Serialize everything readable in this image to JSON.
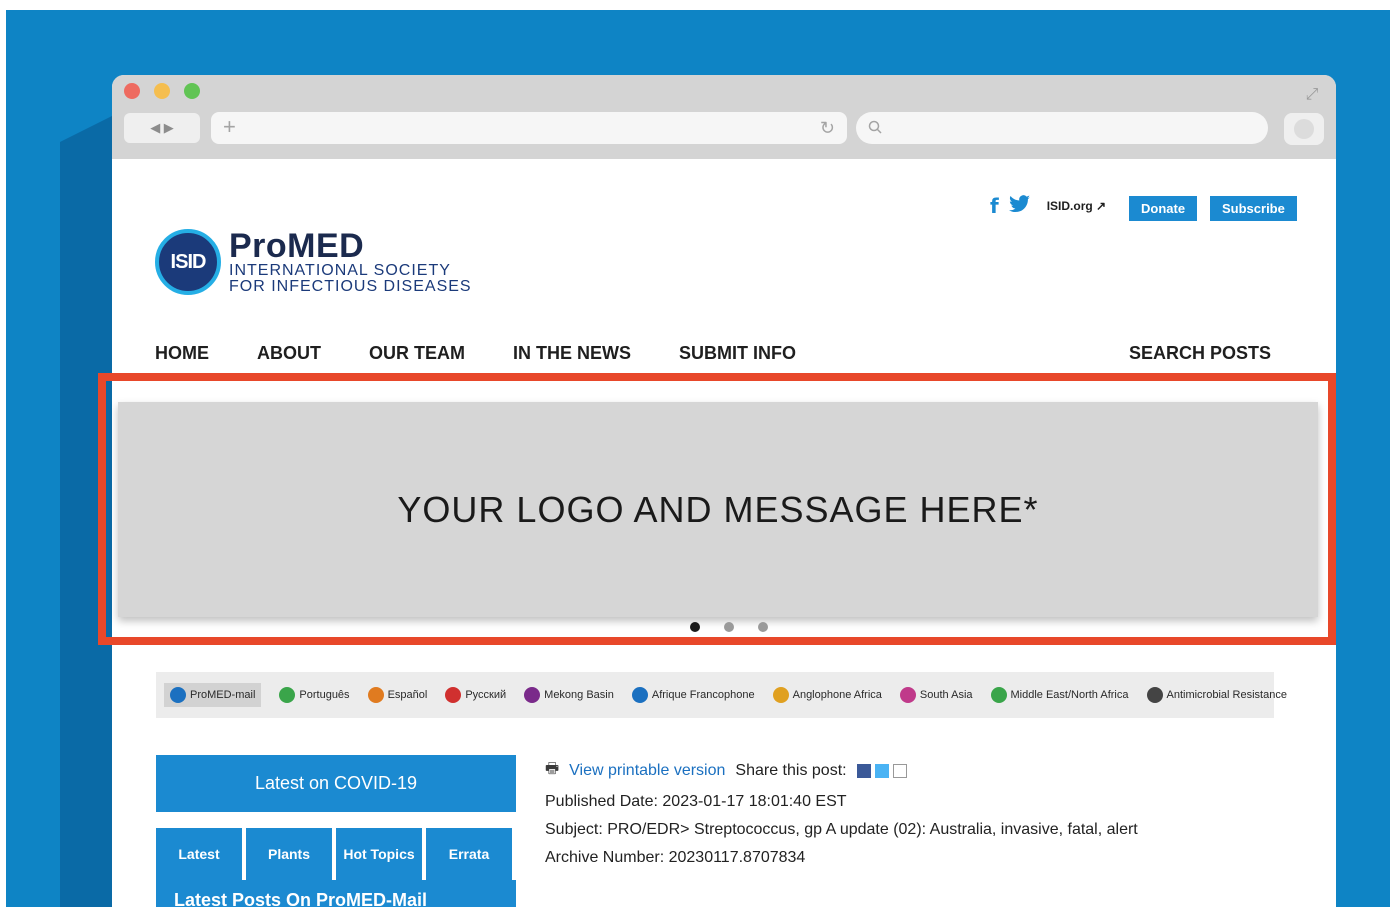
{
  "browser": {
    "nav_arrows": "◀  ▶",
    "address_plus": "+",
    "reload": "↻",
    "search_placeholder": ""
  },
  "header": {
    "social": {
      "facebook": "f",
      "twitter": "t"
    },
    "isid_link": "ISID.org ↗",
    "donate_label": "Donate",
    "subscribe_label": "Subscribe"
  },
  "logo": {
    "badge": "ISID",
    "title": "ProMED",
    "line1": "INTERNATIONAL SOCIETY",
    "line2": "FOR INFECTIOUS DISEASES"
  },
  "nav": {
    "items": [
      "HOME",
      "ABOUT",
      "OUR TEAM",
      "IN THE NEWS",
      "SUBMIT INFO"
    ],
    "search": "SEARCH POSTS"
  },
  "promo": {
    "text": "YOUR LOGO AND MESSAGE HERE*",
    "dots": 3,
    "active_dot": 0
  },
  "languages": [
    {
      "label": "ProMED-mail",
      "color": "#1b70c0",
      "active": true
    },
    {
      "label": "Português",
      "color": "#3aa54a",
      "active": false
    },
    {
      "label": "Español",
      "color": "#e07b20",
      "active": false
    },
    {
      "label": "Русский",
      "color": "#d0302f",
      "active": false
    },
    {
      "label": "Mekong Basin",
      "color": "#7a2a8a",
      "active": false
    },
    {
      "label": "Afrique Francophone",
      "color": "#1b70c0",
      "active": false
    },
    {
      "label": "Anglophone Africa",
      "color": "#e0a020",
      "active": false
    },
    {
      "label": "South Asia",
      "color": "#c03a8a",
      "active": false
    },
    {
      "label": "Middle East/North Africa",
      "color": "#3aa54a",
      "active": false
    },
    {
      "label": "Antimicrobial Resistance",
      "color": "#444444",
      "active": false
    }
  ],
  "sidebar": {
    "covid_label": "Latest on COVID-19",
    "tabs": [
      "Latest",
      "Plants",
      "Hot Topics",
      "Errata"
    ],
    "latest_posts": "Latest Posts On ProMED-Mail"
  },
  "post": {
    "print_label": "View printable version",
    "share_label": "Share this post:",
    "published": "Published Date: 2023-01-17 18:01:40 EST",
    "subject": "Subject: PRO/EDR> Streptococcus, gp A update (02): Australia, invasive, fatal, alert",
    "archive": "Archive Number: 20230117.8707834"
  }
}
